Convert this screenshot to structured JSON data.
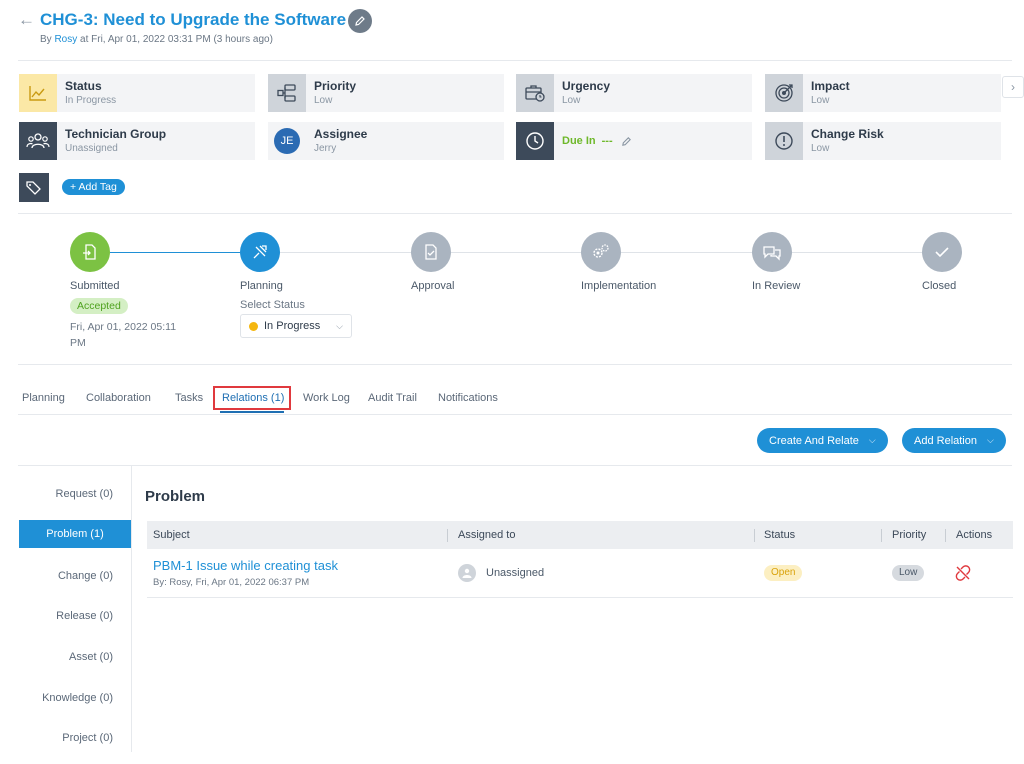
{
  "header": {
    "back_glyph": "←",
    "title": "CHG-3: Need to Upgrade the Software",
    "by_prefix": "By",
    "author": "Rosy",
    "by_suffix": "at Fri, Apr 01, 2022 03:31 PM (3 hours ago)"
  },
  "cards": {
    "status": {
      "label": "Status",
      "value": "In Progress",
      "icon": "chart-line-icon"
    },
    "priority": {
      "label": "Priority",
      "value": "Low",
      "icon": "priority-flow-icon"
    },
    "urgency": {
      "label": "Urgency",
      "value": "Low",
      "icon": "briefcase-clock-icon"
    },
    "impact": {
      "label": "Impact",
      "value": "Low",
      "icon": "target-icon"
    },
    "technician_group": {
      "label": "Technician Group",
      "value": "Unassigned",
      "icon": "users-icon"
    },
    "assignee": {
      "label": "Assignee",
      "value": "Jerry",
      "initials": "JE"
    },
    "due": {
      "label": "Due In",
      "value": "---",
      "icon": "clock-icon"
    },
    "change_risk": {
      "label": "Change Risk",
      "value": "Low",
      "icon": "alert-circle-icon"
    }
  },
  "tags": {
    "add_label": "+ Add Tag"
  },
  "stepper": {
    "steps": [
      {
        "label": "Submitted",
        "state": "done"
      },
      {
        "label": "Planning",
        "state": "current"
      },
      {
        "label": "Approval",
        "state": "pending"
      },
      {
        "label": "Implementation",
        "state": "pending"
      },
      {
        "label": "In Review",
        "state": "pending"
      },
      {
        "label": "Closed",
        "state": "pending"
      }
    ],
    "submitted_badge": "Accepted",
    "submitted_date": "Fri, Apr 01, 2022 05:11 PM",
    "select_status_label": "Select Status",
    "select_status_value": "In Progress"
  },
  "tabs": [
    "Planning",
    "Collaboration",
    "Tasks",
    "Relations (1)",
    "Work Log",
    "Audit Trail",
    "Notifications"
  ],
  "actions": {
    "create_and_relate": "Create And Relate",
    "add_relation": "Add Relation"
  },
  "relation_nav": [
    "Request (0)",
    "Problem (1)",
    "Change (0)",
    "Release (0)",
    "Asset (0)",
    "Knowledge (0)",
    "Project (0)"
  ],
  "panel": {
    "title": "Problem",
    "columns": [
      "Subject",
      "Assigned to",
      "Status",
      "Priority",
      "Actions"
    ],
    "rows": [
      {
        "subject": "PBM-1 Issue while creating task",
        "meta": "By: Rosy, Fri, Apr 01, 2022 06:37 PM",
        "assigned_to": "Unassigned",
        "status": "Open",
        "priority": "Low"
      }
    ]
  },
  "colors": {
    "accent": "#1f90d6",
    "success": "#6eb82a",
    "warning": "#f5b70f",
    "danger": "#e0393e"
  }
}
